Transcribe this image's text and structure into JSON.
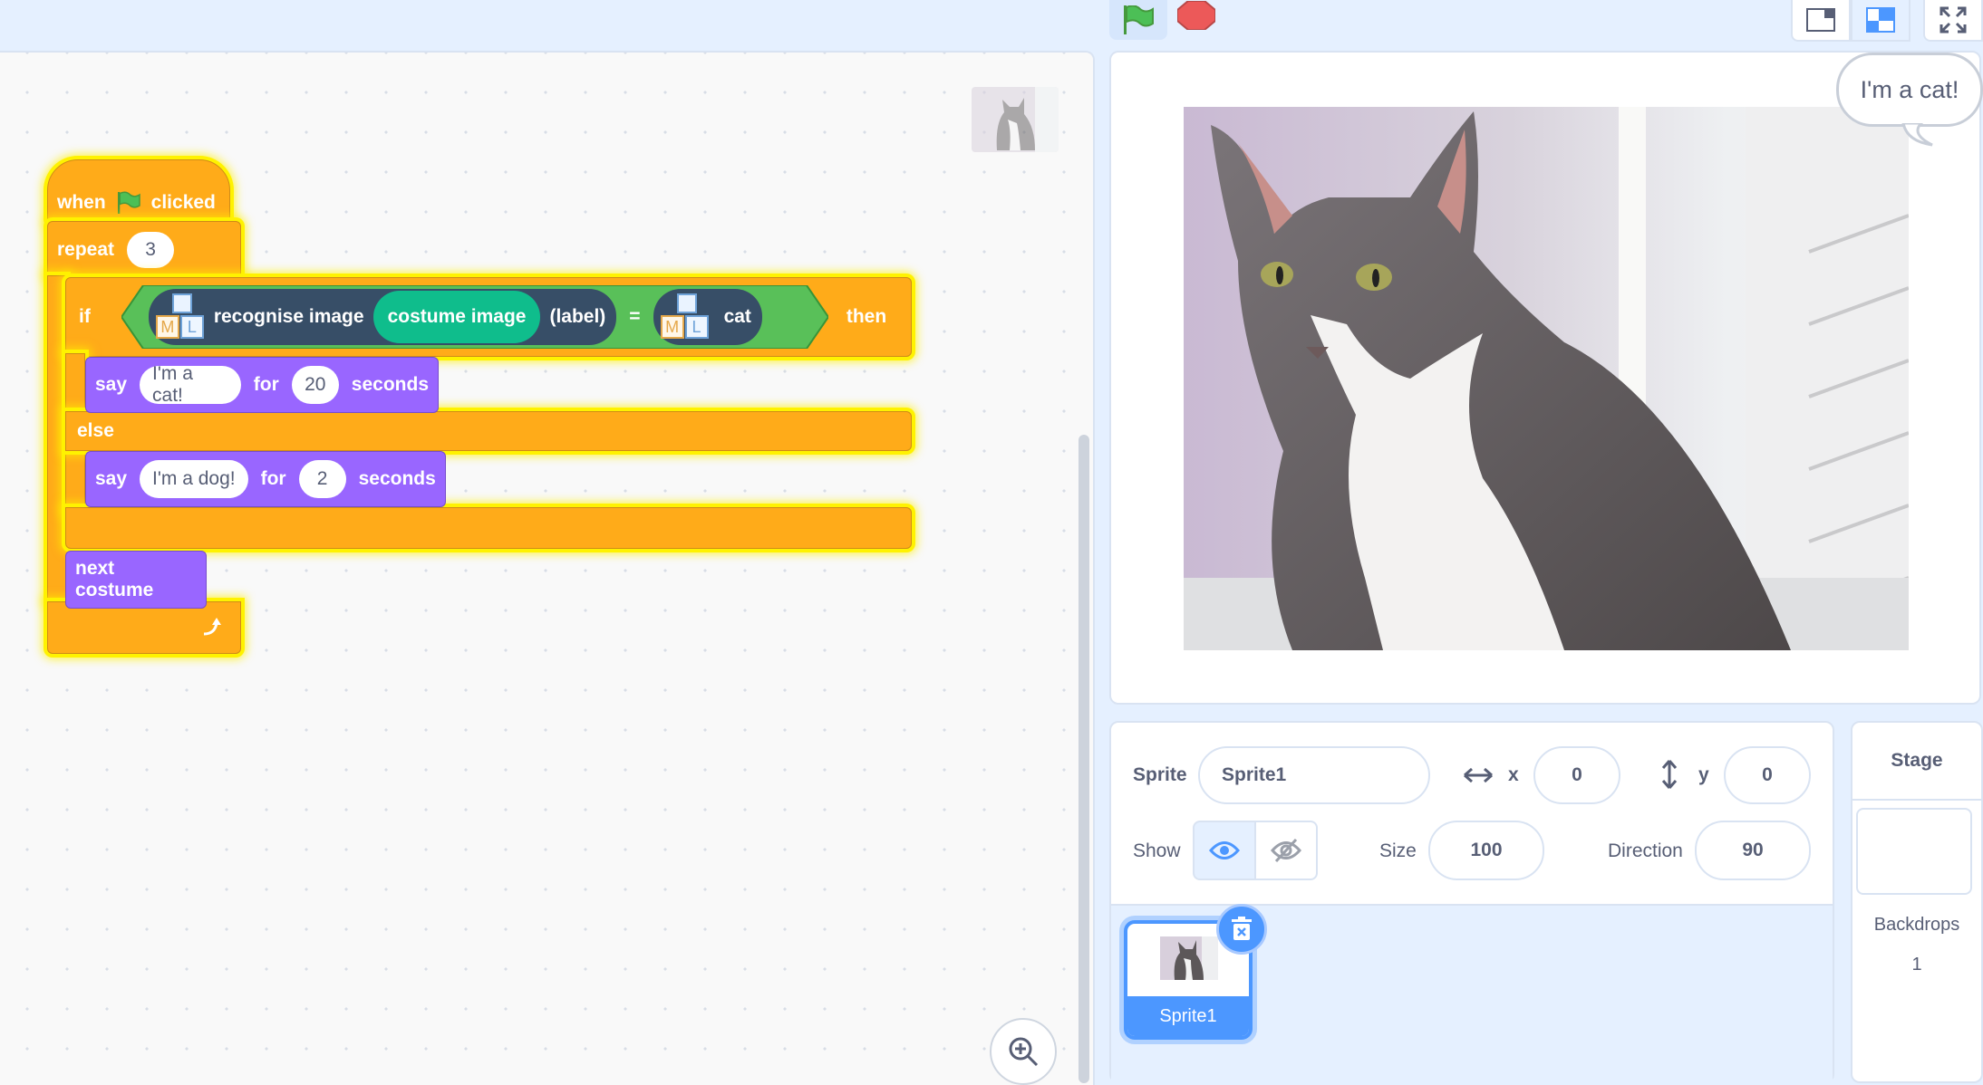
{
  "topbar": {
    "green_flag": "green-flag-icon",
    "stop": "stop-icon"
  },
  "script": {
    "hat": {
      "when": "when",
      "clicked": "clicked"
    },
    "repeat": {
      "label": "repeat",
      "count": "3"
    },
    "if": {
      "label": "if",
      "then": "then",
      "else": "else"
    },
    "recognise": {
      "label": "recognise image",
      "input": "costume image",
      "suffix": "(label)",
      "equals": "=",
      "class_label": "cat"
    },
    "say1": {
      "say": "say",
      "text": "I'm a cat!",
      "for": "for",
      "secs": "20",
      "seconds": "seconds"
    },
    "say2": {
      "say": "say",
      "text": "I'm a dog!",
      "for": "for",
      "secs": "2",
      "seconds": "seconds"
    },
    "next_costume": "next costume",
    "ml_icon": {
      "m": "M",
      "l": "L"
    }
  },
  "stage": {
    "bubble": "I'm a cat!"
  },
  "sprite_info": {
    "sprite_label": "Sprite",
    "sprite_name": "Sprite1",
    "x_label": "x",
    "x_value": "0",
    "y_label": "y",
    "y_value": "0",
    "show_label": "Show",
    "size_label": "Size",
    "size_value": "100",
    "direction_label": "Direction",
    "direction_value": "90"
  },
  "sprite_list": [
    {
      "name": "Sprite1",
      "selected": true
    }
  ],
  "stage_panel": {
    "title": "Stage",
    "backdrops_label": "Backdrops",
    "backdrops_count": "1"
  },
  "colors": {
    "events": "#ffab19",
    "looks": "#9966ff",
    "ml": "#374e67",
    "ml_input": "#0fbd8c",
    "accent": "#4c97ff"
  }
}
